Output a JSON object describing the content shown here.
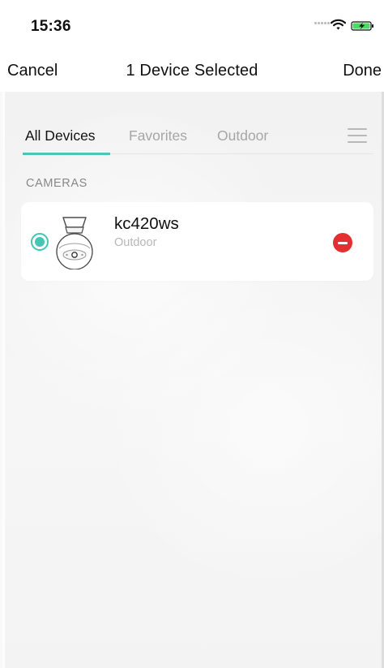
{
  "status_bar": {
    "time": "15:36"
  },
  "nav": {
    "cancel": "Cancel",
    "title": "1 Device Selected",
    "done": "Done"
  },
  "tabs": [
    {
      "label": "All Devices",
      "active": true
    },
    {
      "label": "Favorites",
      "active": false
    },
    {
      "label": "Outdoor",
      "active": false
    }
  ],
  "section": {
    "heading": "CAMERAS"
  },
  "devices": [
    {
      "name": "kc420ws",
      "location": "Outdoor",
      "selected": true,
      "icon": "camera-icon",
      "action_icon": "remove-icon"
    }
  ],
  "colors": {
    "accent": "#45c5b4",
    "remove": "#e32f2f",
    "muted_text": "#a6a6a6",
    "background": "#f4f4f4"
  }
}
